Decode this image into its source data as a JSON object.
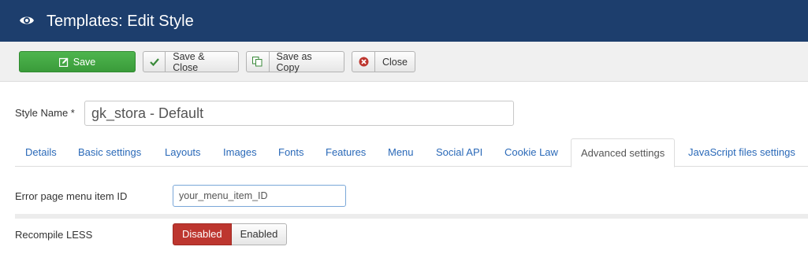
{
  "header": {
    "title": "Templates: Edit Style"
  },
  "toolbar": {
    "save_label": "Save",
    "save_close_label": "Save & Close",
    "save_copy_label": "Save as Copy",
    "close_label": "Close"
  },
  "form": {
    "style_name_label": "Style Name *",
    "style_name_value": "gk_stora - Default"
  },
  "tabs": [
    {
      "label": "Details"
    },
    {
      "label": "Basic settings"
    },
    {
      "label": "Layouts"
    },
    {
      "label": "Images"
    },
    {
      "label": "Fonts"
    },
    {
      "label": "Features"
    },
    {
      "label": "Menu"
    },
    {
      "label": "Social API"
    },
    {
      "label": "Cookie Law"
    },
    {
      "label": "Advanced settings"
    },
    {
      "label": "JavaScript files settings"
    }
  ],
  "active_tab": "Advanced settings",
  "advanced": {
    "error_menu_label": "Error page menu item ID",
    "error_menu_value": "your_menu_item_ID",
    "recompile_label": "Recompile LESS",
    "recompile_options": [
      "Disabled",
      "Enabled"
    ],
    "recompile_selected": "Disabled"
  },
  "colors": {
    "header": "#1d3e6d",
    "save": "#46a546",
    "danger": "#bd362f",
    "link": "#2a69b8"
  }
}
